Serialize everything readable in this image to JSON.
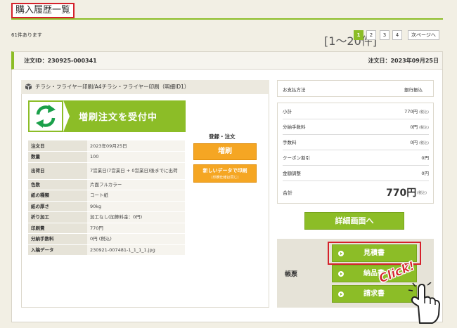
{
  "title": "購入履歴一覧",
  "count": "61件あります",
  "pager": {
    "range": "[1〜20件]",
    "pages": [
      "1",
      "2",
      "3",
      "4"
    ],
    "current": "1",
    "next": "次ページへ"
  },
  "order": {
    "id": "注文ID：230925-000341",
    "date": "注文日：2023年09月25日"
  },
  "item": {
    "name": "チラシ・フライヤー印刷/A4チラシ・フライヤー印刷（明細ID1）",
    "banner": "増刷注文を受付中",
    "specs": [
      {
        "k": "注文日",
        "v": "2023年09月25日"
      },
      {
        "k": "数量",
        "v": "100"
      },
      {
        "k": "出荷日",
        "v": "7営業日(7営業日 + 0営業日)後までに出荷"
      },
      {
        "k": "色数",
        "v": "片面フルカラー"
      },
      {
        "k": "紙の種類",
        "v": "コート紙"
      },
      {
        "k": "紙の厚さ",
        "v": "90kg"
      },
      {
        "k": "折り加工",
        "v": "加工なし(加算料金：0円)"
      },
      {
        "k": "印刷費",
        "v": "770円"
      },
      {
        "k": "分納手数料",
        "v": "0円 (税込)"
      },
      {
        "k": "入稿データ",
        "v": "230921-007481-1_1_1_1.jpg"
      }
    ],
    "register_label": "登録・注文",
    "reprint_button": "増刷",
    "newdata_button": "新しいデータで印刷",
    "newdata_sub": "(印刷仕様は同じ)"
  },
  "payment": {
    "label": "お支払方法",
    "value": "銀行振込"
  },
  "summary": {
    "rows": [
      {
        "k": "小計",
        "v": "770円",
        "tax": "(税込)"
      },
      {
        "k": "分納手数料",
        "v": "0円",
        "tax": "(税込)"
      },
      {
        "k": "手数料",
        "v": "0円",
        "tax": "(税込)"
      },
      {
        "k": "クーポン割引",
        "v": "0円",
        "tax": ""
      },
      {
        "k": "金額調整",
        "v": "0円",
        "tax": ""
      }
    ],
    "total_label": "合計",
    "total_value": "770円",
    "total_tax": "(税込)"
  },
  "detail_button": "詳細画面へ",
  "forms": {
    "label": "帳票",
    "buttons": [
      "見積書",
      "納品書",
      "請求書"
    ]
  },
  "click_annotation": "Click!",
  "colors": {
    "accent": "#8cbd27",
    "orange": "#f5a623",
    "highlight": "#d5212b"
  }
}
